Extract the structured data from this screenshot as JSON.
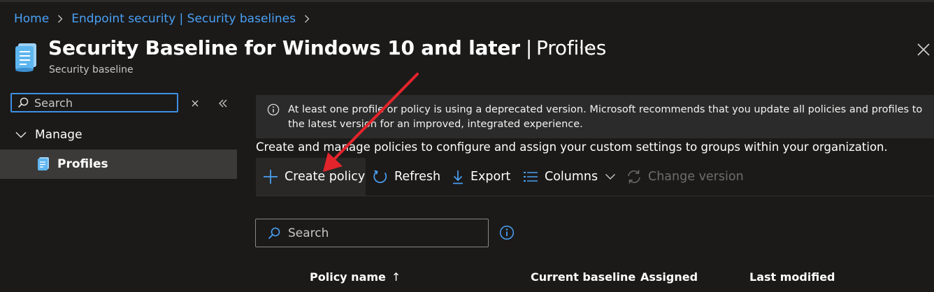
{
  "breadcrumb": [
    {
      "label": "Home"
    },
    {
      "label": "Endpoint security | Security baselines"
    }
  ],
  "header": {
    "title_main": "Security Baseline for Windows 10 and later",
    "title_separator": "|",
    "title_section": "Profiles",
    "subtitle": "Security baseline",
    "more_label": "···"
  },
  "sidebar": {
    "search_placeholder": "Search",
    "group_label": "Manage",
    "selected_item": "Profiles"
  },
  "alert": {
    "icon": "info-icon",
    "text": "At least one profile or policy is using a deprecated version. Microsoft recommends that you update all policies and profiles to the latest version for an improved, integrated experience."
  },
  "description": "Create and manage policies to configure and assign your custom settings to groups within your organization.",
  "toolbar": {
    "create_label": "Create policy",
    "refresh_label": "Refresh",
    "export_label": "Export",
    "columns_label": "Columns",
    "change_version_label": "Change version"
  },
  "main": {
    "search_placeholder": "Search"
  },
  "table": {
    "columns": [
      "Policy name",
      "Current baseline",
      "Assigned",
      "Last modified"
    ],
    "sort_indicator": "↑"
  },
  "colors": {
    "background": "#1b1a19",
    "accent": "#4aa0f5",
    "annotation_arrow": "#e3242b"
  }
}
